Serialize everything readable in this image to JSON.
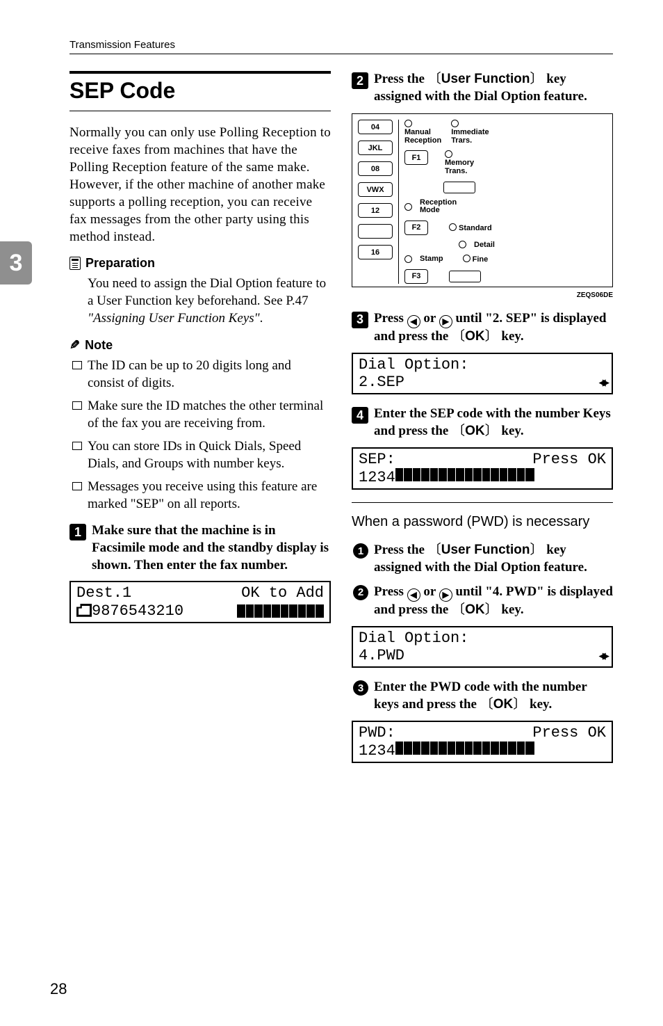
{
  "header": {
    "title": "Transmission Features"
  },
  "chapter_tab": "3",
  "page_number": "28",
  "left": {
    "h1": "SEP Code",
    "intro": "Normally you can only use Polling Reception to receive faxes from machines that have the Polling Reception feature of the same make. However, if the other machine of another make supports a polling reception, you can receive fax messages from the other party using this method instead.",
    "prep_label": "Preparation",
    "prep_body_a": "You need to assign the Dial Option feature to a User Function key beforehand. See P.47 ",
    "prep_body_b": "\"Assigning User Function Keys\"",
    "prep_body_c": ".",
    "note_label": "Note",
    "notes": [
      "The ID can be up to 20 digits long and consist of digits.",
      "Make sure the ID matches the other terminal of the fax you are receiving from.",
      "You can store IDs in Quick Dials, Speed Dials, and Groups with number keys.",
      "Messages you receive using this feature are marked \"SEP\" on all reports."
    ],
    "step1": "Make sure that the machine is in Facsimile mode and the standby display is shown. Then enter the fax number.",
    "lcd1_left": "Dest.1",
    "lcd1_right": "OK to Add",
    "lcd1_b": "9876543210"
  },
  "right": {
    "step2_a": "Press the ",
    "step2_key": "User Function",
    "step2_b": " key assigned with the Dial Option feature.",
    "panel_caption": "ZEQS06DE",
    "panel": {
      "keys_col": [
        "04",
        "JKL",
        "08",
        "VWX",
        "12",
        "",
        "16"
      ],
      "manual_reception": "Manual\nReception",
      "reception_mode": "Reception\nMode",
      "stamp": "Stamp",
      "f1": "F1",
      "f2": "F2",
      "f3": "F3",
      "immediate": "Immediate\nTrars.",
      "memory": "Memory\nTrans.",
      "standard": "Standard",
      "detail": "Detail",
      "fine": "Fine"
    },
    "step3_a": "Press ",
    "step3_b": " or ",
    "step3_c": " until \"2. SEP\" is displayed and press the ",
    "step3_key": "OK",
    "step3_d": " key.",
    "lcd3_a": "Dial Option:",
    "lcd3_b": "2.SEP",
    "step4_a": "Enter the SEP code with the number Keys and press the ",
    "step4_key": "OK",
    "step4_b": " key.",
    "lcd4_a": "SEP:",
    "lcd4_a_r": "Press OK",
    "lcd4_b": "1234",
    "subsec": "When a password (PWD) is necessary",
    "sub1_a": "Press the ",
    "sub1_key": "User Function",
    "sub1_b": " key assigned with the Dial Option feature.",
    "sub2_a": "Press ",
    "sub2_b": " or ",
    "sub2_c": " until \"4. PWD\" is displayed and press the ",
    "sub2_key": "OK",
    "sub2_d": " key.",
    "lcd_s2_a": "Dial Option:",
    "lcd_s2_b": "4.PWD",
    "sub3_a": "Enter the PWD code with the number keys and press the ",
    "sub3_key": "OK",
    "sub3_b": " key.",
    "lcd_s3_a": "PWD:",
    "lcd_s3_a_r": "Press OK",
    "lcd_s3_b": "1234"
  }
}
